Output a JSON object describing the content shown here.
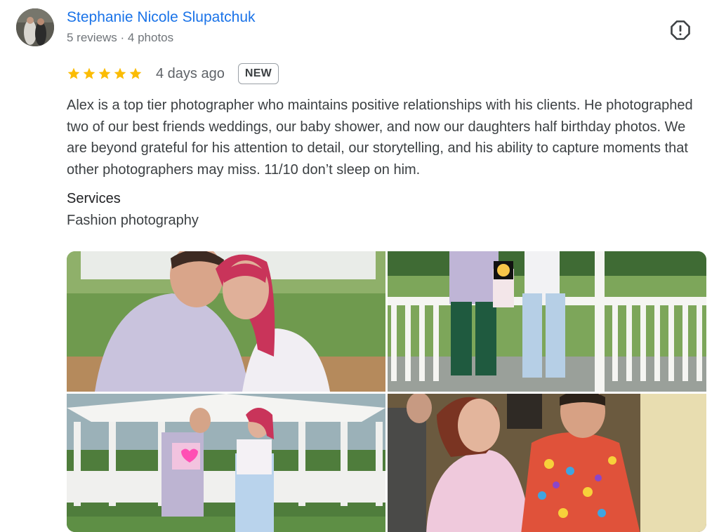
{
  "reviewer": {
    "name": "Stephanie Nicole Slupatchuk",
    "meta": "5 reviews · 4 photos"
  },
  "review": {
    "rating": 5,
    "rating_max": 5,
    "date": "4 days ago",
    "badge": "NEW",
    "text": "Alex is a top tier photographer who maintains positive relationships with his clients. He photographed two of our best friends weddings, our baby shower, and now our daughters half birthday photos. We are beyond grateful for his attention to detail, our storytelling, and his ability to capture moments that other photographers may miss. 11/10 don’t sleep on him.",
    "services_label": "Services",
    "services_value": "Fashion photography"
  },
  "icons": {
    "star": "star-icon",
    "report": "report-icon"
  },
  "colors": {
    "name_link": "#1a73e8",
    "star": "#fbbc04",
    "secondary_text": "#70757a"
  }
}
